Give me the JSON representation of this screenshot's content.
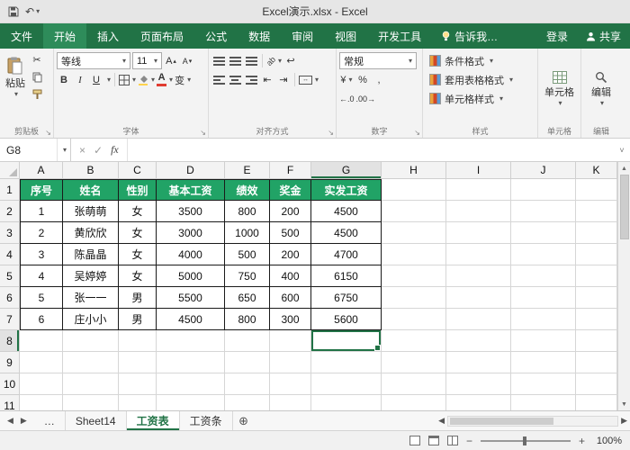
{
  "title_bar": {
    "title": "Excel演示.xlsx - Excel"
  },
  "ribbon": {
    "tabs": [
      {
        "label": "文件",
        "id": "file"
      },
      {
        "label": "开始",
        "id": "home",
        "active": true
      },
      {
        "label": "插入"
      },
      {
        "label": "页面布局"
      },
      {
        "label": "公式"
      },
      {
        "label": "数据"
      },
      {
        "label": "审阅"
      },
      {
        "label": "视图"
      },
      {
        "label": "开发工具"
      }
    ],
    "tell_me": "告诉我…",
    "sign_in": "登录",
    "share": "共享",
    "clipboard": {
      "label": "剪贴板",
      "paste": "粘贴"
    },
    "font": {
      "label": "字体",
      "font_name": "等线",
      "font_size": "11",
      "bold": "B",
      "italic": "I",
      "underline": "U",
      "phonetic": "变"
    },
    "alignment": {
      "label": "对齐方式"
    },
    "number": {
      "label": "数字",
      "format": "常规",
      "currency": "¥",
      "percent": "%",
      "comma": ","
    },
    "styles": {
      "label": "样式",
      "items": [
        "条件格式",
        "套用表格格式",
        "单元格样式"
      ]
    },
    "cells": {
      "label": "单元格"
    },
    "editing": {
      "label": "编辑"
    }
  },
  "formula_bar": {
    "name_box": "G8",
    "fx": "fx",
    "value": ""
  },
  "grid": {
    "columns": [
      "A",
      "B",
      "C",
      "D",
      "E",
      "F",
      "G",
      "H",
      "I",
      "J",
      "K"
    ],
    "row_numbers": [
      1,
      2,
      3,
      4,
      5,
      6,
      7,
      8,
      9,
      10,
      11
    ],
    "selected_cell": "G8",
    "table": {
      "origin": "A1",
      "headers": [
        "序号",
        "姓名",
        "性别",
        "基本工资",
        "绩效",
        "奖金",
        "实发工资"
      ],
      "rows": [
        [
          "1",
          "张萌萌",
          "女",
          "3500",
          "800",
          "200",
          "4500"
        ],
        [
          "2",
          "黄欣欣",
          "女",
          "3000",
          "1000",
          "500",
          "4500"
        ],
        [
          "3",
          "陈晶晶",
          "女",
          "4000",
          "500",
          "200",
          "4700"
        ],
        [
          "4",
          "吴婷婷",
          "女",
          "5000",
          "750",
          "400",
          "6150"
        ],
        [
          "5",
          "张一一",
          "男",
          "5500",
          "650",
          "600",
          "6750"
        ],
        [
          "6",
          "庄小小",
          "男",
          "4500",
          "800",
          "300",
          "5600"
        ]
      ],
      "header_bg": "#21a366",
      "header_text": "#ffffff"
    }
  },
  "sheet_bar": {
    "ellipsis": "…",
    "tabs": [
      {
        "label": "Sheet14"
      },
      {
        "label": "工资表",
        "active": true
      },
      {
        "label": "工资条"
      }
    ]
  },
  "status_bar": {
    "zoom": "100%"
  },
  "colors": {
    "accent": "#217346",
    "table_header": "#21a366"
  },
  "icons": {
    "dropdown": "▾",
    "expand": "˅",
    "close": "×",
    "check": "✓",
    "scissors": "✂",
    "undo": "↶",
    "left": "◀",
    "right": "▶",
    "up": "▲",
    "down": "▼",
    "add_sheet": "⊕",
    "wrap": "↩",
    "merge_arrows": "↔",
    "indent_left": "⇤",
    "indent_right": "⇥",
    "launcher": "↘",
    "minus": "−",
    "plus": "+",
    "dec_inc": "←.0",
    "dec_dec": ".00→",
    "orientation": "ab",
    "font_bigger": "▴",
    "font_smaller": "▾",
    "font_letter": "A"
  }
}
